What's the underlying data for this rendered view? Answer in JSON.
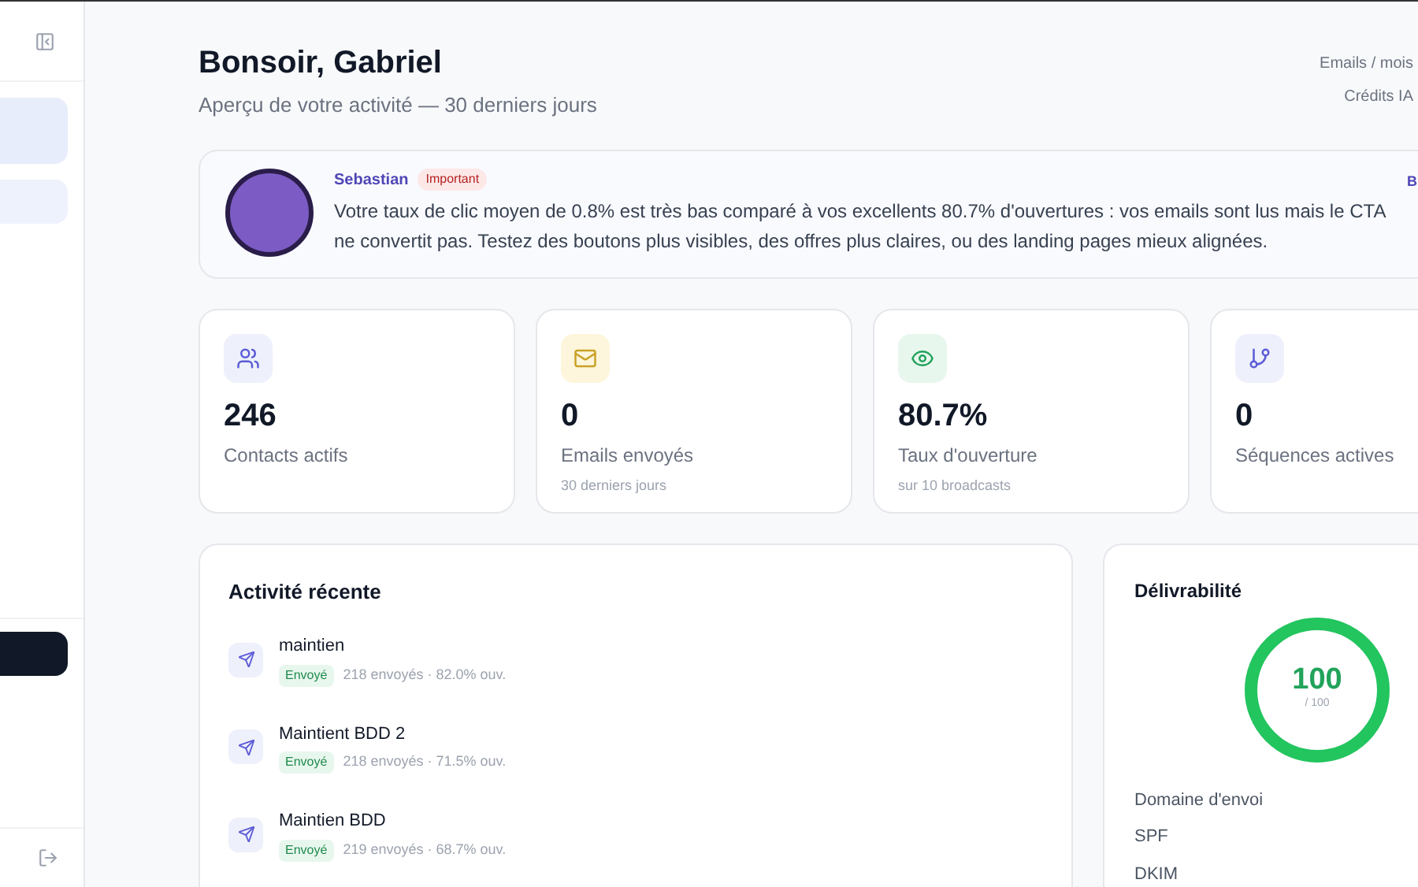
{
  "header": {
    "title": "Bonsoir, Gabriel",
    "subtitle": "Aperçu de votre activité — 30 derniers jours",
    "quota_labels": [
      "Emails / mois",
      "Crédits IA"
    ]
  },
  "insight": {
    "author": "Sebastian",
    "badge": "Important",
    "message": "Votre taux de clic moyen de 0.8% est très bas comparé à vos excellents 80.7% d'ouvertures : vos emails sont lus mais le CTA ne convertit pas. Testez des boutons plus visibles, des offres plus claires, ou des landing pages mieux alignées.",
    "side_text": "B"
  },
  "stats": [
    {
      "kind": "contacts",
      "value": "246",
      "label": "Contacts actifs"
    },
    {
      "kind": "emails",
      "value": "0",
      "label": "Emails envoyés",
      "note": "30 derniers jours"
    },
    {
      "kind": "opens",
      "value": "80.7%",
      "label": "Taux d'ouverture",
      "note": "sur 10 broadcasts"
    },
    {
      "kind": "sequences",
      "value": "0",
      "label": "Séquences actives"
    }
  ],
  "activity": {
    "title": "Activité récente",
    "items": [
      {
        "name": "maintien",
        "status": "Envoyé",
        "meta": "218 envoyés · 82.0% ouv."
      },
      {
        "name": "Maintient BDD 2",
        "status": "Envoyé",
        "meta": "218 envoyés · 71.5% ouv."
      },
      {
        "name": "Maintien BDD",
        "status": "Envoyé",
        "meta": "219 envoyés · 68.7% ouv."
      }
    ]
  },
  "deliverability": {
    "title": "Délivrabilité",
    "score": "100",
    "max": "/ 100",
    "level": 1,
    "checks": [
      "Domaine d'envoi",
      "SPF",
      "DKIM"
    ]
  }
}
